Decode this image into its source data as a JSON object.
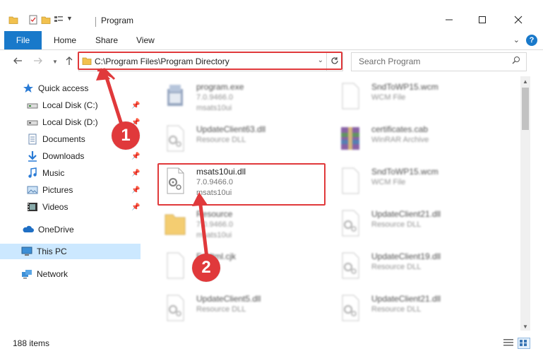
{
  "window": {
    "title": "Program",
    "minimize_icon": "minimize-icon",
    "maximize_icon": "maximize-icon",
    "close_icon": "close-icon"
  },
  "ribbon": {
    "file": "File",
    "home": "Home",
    "share": "Share",
    "view": "View"
  },
  "address": {
    "path": "C:\\Program Files\\Program Directory"
  },
  "search": {
    "placeholder": "Search Program"
  },
  "nav": {
    "items": [
      {
        "label": "Quick access",
        "icon": "star-icon"
      },
      {
        "label": "Local Disk (C:)",
        "icon": "drive-icon"
      },
      {
        "label": "Local Disk (D:)",
        "icon": "drive-icon"
      },
      {
        "label": "Documents",
        "icon": "documents-icon"
      },
      {
        "label": "Downloads",
        "icon": "downloads-icon"
      },
      {
        "label": "Music",
        "icon": "music-icon"
      },
      {
        "label": "Pictures",
        "icon": "pictures-icon"
      },
      {
        "label": "Videos",
        "icon": "videos-icon"
      },
      {
        "label": "OneDrive",
        "icon": "cloud-icon"
      },
      {
        "label": "This PC",
        "icon": "computer-icon"
      },
      {
        "label": "Network",
        "icon": "network-icon"
      }
    ]
  },
  "files": [
    {
      "name": "program.exe",
      "line1": "7.0.9466.0",
      "line2": "msats10ui"
    },
    {
      "name": "SndToWP15.wcm",
      "line1": "WCM File",
      "line2": ""
    },
    {
      "name": "UpdateClient63.dll",
      "line1": "Resource DLL",
      "line2": ""
    },
    {
      "name": "certificates.cab",
      "line1": "WinRAR Archive",
      "line2": ""
    },
    {
      "name": "msats10ui.dll",
      "line1": "7.0.9466.0",
      "line2": "msats10ui"
    },
    {
      "name": "SndToWP15.wcm",
      "line1": "WCM File",
      "line2": ""
    },
    {
      "name": "Resource",
      "line1": "7.0.9466.0",
      "line2": "msats10ui"
    },
    {
      "name": "UpdateClient21.dll",
      "line1": "Resource DLL",
      "line2": ""
    },
    {
      "name": "FxHtml.cjk",
      "line1": "",
      "line2": ""
    },
    {
      "name": "UpdateClient19.dll",
      "line1": "Resource DLL",
      "line2": ""
    },
    {
      "name": "UpdateClient5.dll",
      "line1": "Resource DLL",
      "line2": ""
    },
    {
      "name": "UpdateClient21.dll",
      "line1": "Resource DLL",
      "line2": ""
    }
  ],
  "annotations": {
    "step1": "1",
    "step2": "2"
  },
  "status": {
    "count": "188 items"
  },
  "colors": {
    "accent": "#1979ca",
    "highlight": "#e0393b",
    "selection": "#cce8ff"
  }
}
